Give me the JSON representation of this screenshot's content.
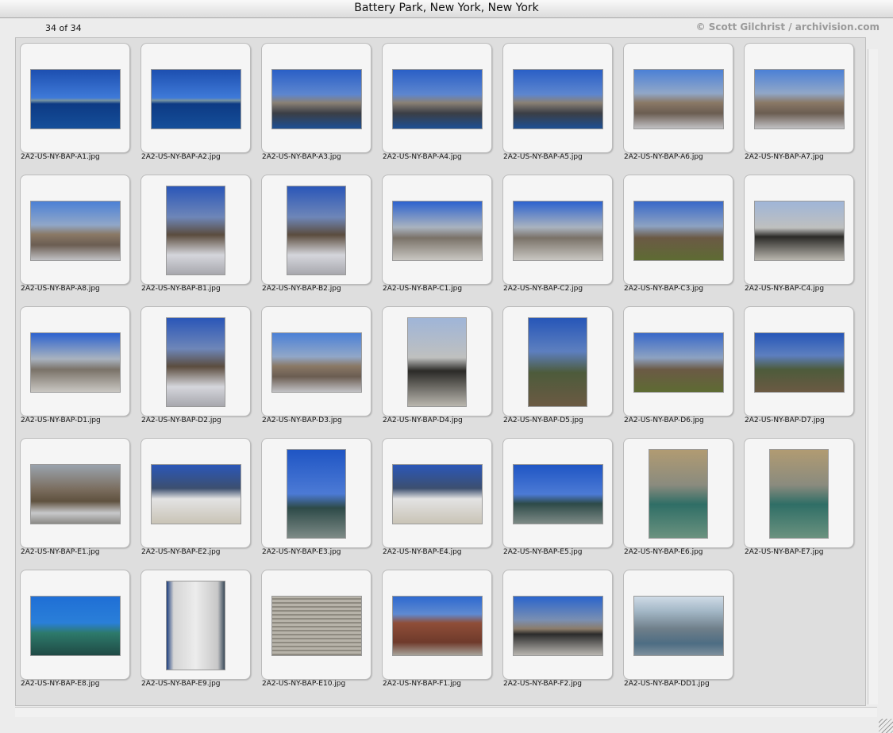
{
  "window": {
    "title": "Battery Park, New York, New York"
  },
  "header": {
    "count": "34 of 34",
    "credit": "© Scott Gilchrist / archivision.com"
  },
  "thumbnails": [
    {
      "filename": "2A2-US-NY-BAP-A1.jpg",
      "orientation": "landscape",
      "style": "harbor"
    },
    {
      "filename": "2A2-US-NY-BAP-A2.jpg",
      "orientation": "landscape",
      "style": "harbor"
    },
    {
      "filename": "2A2-US-NY-BAP-A3.jpg",
      "orientation": "landscape",
      "style": "pier"
    },
    {
      "filename": "2A2-US-NY-BAP-A4.jpg",
      "orientation": "landscape",
      "style": "pier"
    },
    {
      "filename": "2A2-US-NY-BAP-A5.jpg",
      "orientation": "landscape",
      "style": "pier"
    },
    {
      "filename": "2A2-US-NY-BAP-A6.jpg",
      "orientation": "landscape",
      "style": "park"
    },
    {
      "filename": "2A2-US-NY-BAP-A7.jpg",
      "orientation": "landscape",
      "style": "park"
    },
    {
      "filename": "2A2-US-NY-BAP-A8.jpg",
      "orientation": "landscape",
      "style": "park"
    },
    {
      "filename": "2A2-US-NY-BAP-B1.jpg",
      "orientation": "portrait",
      "style": "path"
    },
    {
      "filename": "2A2-US-NY-BAP-B2.jpg",
      "orientation": "portrait",
      "style": "path"
    },
    {
      "filename": "2A2-US-NY-BAP-C1.jpg",
      "orientation": "landscape",
      "style": "plaza"
    },
    {
      "filename": "2A2-US-NY-BAP-C2.jpg",
      "orientation": "landscape",
      "style": "plaza"
    },
    {
      "filename": "2A2-US-NY-BAP-C3.jpg",
      "orientation": "landscape",
      "style": "lawn"
    },
    {
      "filename": "2A2-US-NY-BAP-C4.jpg",
      "orientation": "landscape",
      "style": "statue"
    },
    {
      "filename": "2A2-US-NY-BAP-D1.jpg",
      "orientation": "landscape",
      "style": "plaza"
    },
    {
      "filename": "2A2-US-NY-BAP-D2.jpg",
      "orientation": "portrait",
      "style": "path"
    },
    {
      "filename": "2A2-US-NY-BAP-D3.jpg",
      "orientation": "landscape",
      "style": "park"
    },
    {
      "filename": "2A2-US-NY-BAP-D4.jpg",
      "orientation": "portrait",
      "style": "statue"
    },
    {
      "filename": "2A2-US-NY-BAP-D5.jpg",
      "orientation": "portrait",
      "style": "monu"
    },
    {
      "filename": "2A2-US-NY-BAP-D6.jpg",
      "orientation": "landscape",
      "style": "lawn"
    },
    {
      "filename": "2A2-US-NY-BAP-D7.jpg",
      "orientation": "landscape",
      "style": "monu"
    },
    {
      "filename": "2A2-US-NY-BAP-E1.jpg",
      "orientation": "landscape",
      "style": "trees"
    },
    {
      "filename": "2A2-US-NY-BAP-E2.jpg",
      "orientation": "landscape",
      "style": "slabs"
    },
    {
      "filename": "2A2-US-NY-BAP-E3.jpg",
      "orientation": "portrait",
      "style": "eagleP"
    },
    {
      "filename": "2A2-US-NY-BAP-E4.jpg",
      "orientation": "landscape",
      "style": "slabs"
    },
    {
      "filename": "2A2-US-NY-BAP-E5.jpg",
      "orientation": "landscape",
      "style": "eagleP"
    },
    {
      "filename": "2A2-US-NY-BAP-E6.jpg",
      "orientation": "portrait",
      "style": "eagleT"
    },
    {
      "filename": "2A2-US-NY-BAP-E7.jpg",
      "orientation": "portrait",
      "style": "eagleT"
    },
    {
      "filename": "2A2-US-NY-BAP-E8.jpg",
      "orientation": "landscape",
      "style": "eagleC"
    },
    {
      "filename": "2A2-US-NY-BAP-E9.jpg",
      "orientation": "portrait",
      "style": "wall"
    },
    {
      "filename": "2A2-US-NY-BAP-E10.jpg",
      "orientation": "landscape",
      "style": "text"
    },
    {
      "filename": "2A2-US-NY-BAP-F1.jpg",
      "orientation": "landscape",
      "style": "fort"
    },
    {
      "filename": "2A2-US-NY-BAP-F2.jpg",
      "orientation": "landscape",
      "style": "canopy"
    },
    {
      "filename": "2A2-US-NY-BAP-DD1.jpg",
      "orientation": "landscape",
      "style": "aerial"
    }
  ]
}
